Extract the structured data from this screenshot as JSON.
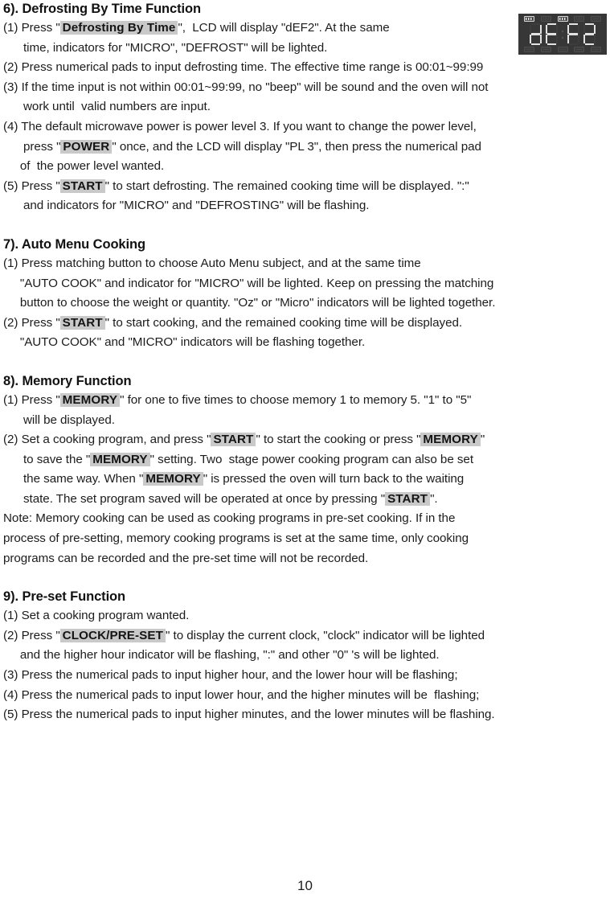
{
  "page": {
    "number": "10"
  },
  "lcd": {
    "display_text": "dEF2",
    "digits": [
      "d",
      "E",
      "F",
      "2"
    ],
    "background_color": "#373737",
    "segment_color": "#e2e2e2",
    "top_indicators": [
      {
        "name": "micro-indicator",
        "lit": true
      },
      {
        "name": "grill-indicator",
        "lit": false
      },
      {
        "name": "defrost-indicator",
        "lit": true
      },
      {
        "name": "convection-indicator",
        "lit": false
      },
      {
        "name": "combination-indicator",
        "lit": false
      }
    ],
    "bottom_indicators": [
      {
        "name": "clock-indicator",
        "lit": false
      },
      {
        "name": "auto-cook-indicator",
        "lit": false
      },
      {
        "name": "weight-indicator",
        "lit": false
      },
      {
        "name": "memory-indicator",
        "lit": false
      },
      {
        "name": "lock-indicator",
        "lit": false
      }
    ]
  },
  "highlight_color": "#c9c9c9",
  "sections": [
    {
      "id": "defrosting-by-time",
      "heading": "6). Defrosting By Time Function",
      "items": [
        {
          "lines": [
            {
              "parts": [
                {
                  "t": "(1) Press \"",
                  "style": "normal"
                },
                {
                  "t": "Defrosting By Time",
                  "style": "button"
                },
                {
                  "t": "\",  LCD will display \"dEF2\". At the same",
                  "style": "normal"
                }
              ]
            },
            {
              "parts": [
                {
                  "t": "      time, indicators for \"MICRO\", \"DEFROST\" will be lighted.",
                  "style": "normal"
                }
              ]
            }
          ]
        },
        {
          "lines": [
            {
              "parts": [
                {
                  "t": "(2) Press numerical pads to input defrosting time. The effective time range is 00:01~99:99",
                  "style": "normal"
                }
              ]
            }
          ]
        },
        {
          "lines": [
            {
              "parts": [
                {
                  "t": "(3) If the time input is not within 00:01~99:99, no \"beep\" will be sound and the oven will not",
                  "style": "normal"
                }
              ]
            },
            {
              "parts": [
                {
                  "t": "      work until  valid numbers are input.",
                  "style": "normal"
                }
              ]
            }
          ]
        },
        {
          "lines": [
            {
              "parts": [
                {
                  "t": "(4) The default microwave power is power level 3. If you want to change the power level,",
                  "style": "normal"
                }
              ]
            },
            {
              "parts": [
                {
                  "t": "      press \"",
                  "style": "normal"
                },
                {
                  "t": "POWER",
                  "style": "button"
                },
                {
                  "t": "\" once, and the LCD will display \"PL 3\", then press the numerical pad",
                  "style": "normal"
                }
              ]
            },
            {
              "parts": [
                {
                  "t": "     of  the power level wanted.",
                  "style": "normal"
                }
              ]
            }
          ]
        },
        {
          "lines": [
            {
              "parts": [
                {
                  "t": "(5) Press \"",
                  "style": "normal"
                },
                {
                  "t": "START",
                  "style": "button"
                },
                {
                  "t": "\" to start defrosting. The remained cooking time will be displayed. \":\"",
                  "style": "normal"
                }
              ]
            },
            {
              "parts": [
                {
                  "t": "      and indicators for \"MICRO\" and \"DEFROSTING\" will be flashing.",
                  "style": "normal"
                }
              ]
            }
          ]
        }
      ]
    },
    {
      "id": "auto-menu-cooking",
      "heading": "7). Auto Menu Cooking",
      "items": [
        {
          "lines": [
            {
              "parts": [
                {
                  "t": "(1) Press matching button to choose Auto Menu subject, and at the same time",
                  "style": "normal"
                }
              ]
            },
            {
              "parts": [
                {
                  "t": "     \"AUTO COOK\" and indicator for \"MICRO\" will be lighted. Keep on pressing the matching",
                  "style": "normal"
                }
              ]
            },
            {
              "parts": [
                {
                  "t": "     button to choose the weight or quantity. \"Oz\" or \"Micro\" indicators will be lighted together.",
                  "style": "normal"
                }
              ]
            }
          ]
        },
        {
          "lines": [
            {
              "parts": [
                {
                  "t": "(2) Press \"",
                  "style": "normal"
                },
                {
                  "t": "START",
                  "style": "button"
                },
                {
                  "t": "\" to start cooking, and the remained cooking time will be displayed.",
                  "style": "normal"
                }
              ]
            },
            {
              "parts": [
                {
                  "t": "     \"AUTO COOK\" and \"MICRO\" indicators will be flashing together.",
                  "style": "normal"
                }
              ]
            }
          ]
        }
      ]
    },
    {
      "id": "memory-function",
      "heading": "8). Memory Function",
      "items": [
        {
          "lines": [
            {
              "parts": [
                {
                  "t": "(1) Press \"",
                  "style": "normal"
                },
                {
                  "t": "MEMORY",
                  "style": "button"
                },
                {
                  "t": "\" for one to five times to choose memory 1 to memory 5. \"1\" to \"5\"",
                  "style": "normal"
                }
              ]
            },
            {
              "parts": [
                {
                  "t": "      will be displayed.",
                  "style": "normal"
                }
              ]
            }
          ]
        },
        {
          "lines": [
            {
              "parts": [
                {
                  "t": "(2) Set a cooking program, and press \"",
                  "style": "normal"
                },
                {
                  "t": "START",
                  "style": "button"
                },
                {
                  "t": "\" to start the cooking or press \"",
                  "style": "normal"
                },
                {
                  "t": "MEMORY",
                  "style": "button"
                },
                {
                  "t": "\"",
                  "style": "normal"
                }
              ]
            },
            {
              "parts": [
                {
                  "t": "      to save the \"",
                  "style": "normal"
                },
                {
                  "t": "MEMORY",
                  "style": "button"
                },
                {
                  "t": "\" setting. Two  stage power cooking program can also be set",
                  "style": "normal"
                }
              ]
            },
            {
              "parts": [
                {
                  "t": "      the same way. When \"",
                  "style": "normal"
                },
                {
                  "t": "MEMORY",
                  "style": "button"
                },
                {
                  "t": "\" is pressed the oven will turn back to the waiting",
                  "style": "normal"
                }
              ]
            },
            {
              "parts": [
                {
                  "t": "      state. The set program saved will be operated at once by pressing \"",
                  "style": "normal"
                },
                {
                  "t": "START",
                  "style": "button"
                },
                {
                  "t": "\".",
                  "style": "normal"
                }
              ]
            }
          ]
        },
        {
          "lines": [
            {
              "parts": [
                {
                  "t": "Note: Memory cooking can be used as cooking programs in pre-set cooking. If in the",
                  "style": "normal"
                }
              ]
            },
            {
              "parts": [
                {
                  "t": "process of pre-setting, memory cooking programs is set at the same time, only cooking",
                  "style": "normal"
                }
              ]
            },
            {
              "parts": [
                {
                  "t": "programs can be recorded and the pre-set time will not be recorded.",
                  "style": "normal"
                }
              ]
            }
          ]
        }
      ]
    },
    {
      "id": "pre-set-function",
      "heading": "9). Pre-set Function",
      "items": [
        {
          "lines": [
            {
              "parts": [
                {
                  "t": "(1) Set a cooking program wanted.",
                  "style": "normal"
                }
              ]
            }
          ]
        },
        {
          "lines": [
            {
              "parts": [
                {
                  "t": "(2) Press \"",
                  "style": "normal"
                },
                {
                  "t": "CLOCK/PRE-SET",
                  "style": "button"
                },
                {
                  "t": "\" to display the current clock, \"clock\" indicator will be lighted",
                  "style": "normal"
                }
              ]
            },
            {
              "parts": [
                {
                  "t": "     and the higher hour indicator will be flashing, \":\" and other \"0\" 's will be lighted.",
                  "style": "normal"
                }
              ]
            }
          ]
        },
        {
          "lines": [
            {
              "parts": [
                {
                  "t": "(3) Press the numerical pads to input higher hour, and the lower hour will be flashing;",
                  "style": "normal"
                }
              ]
            }
          ]
        },
        {
          "lines": [
            {
              "parts": [
                {
                  "t": "(4) Press the numerical pads to input lower hour, and the higher minutes will be  flashing;",
                  "style": "normal"
                }
              ]
            }
          ]
        },
        {
          "lines": [
            {
              "parts": [
                {
                  "t": "(5) Press the numerical pads to input higher minutes, and the lower minutes will be flashing.",
                  "style": "normal"
                }
              ]
            }
          ]
        }
      ]
    }
  ]
}
